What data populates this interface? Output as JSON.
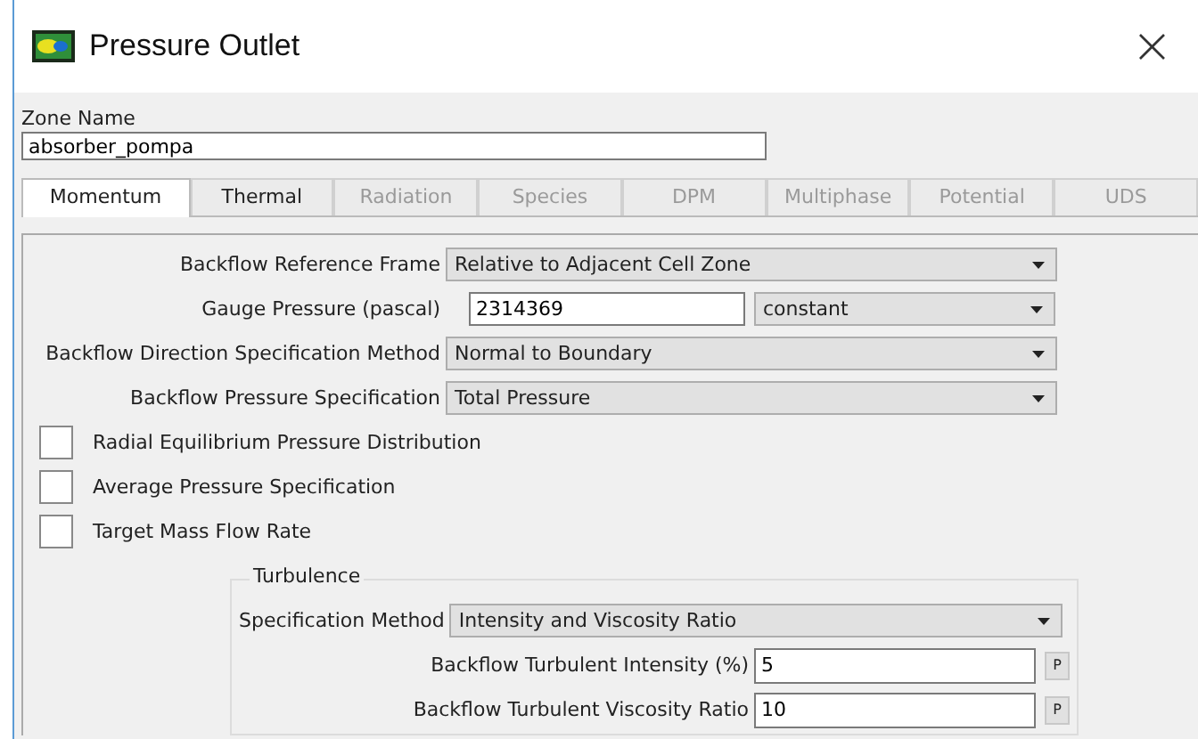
{
  "window": {
    "title": "Pressure Outlet",
    "close": "×"
  },
  "zone": {
    "label": "Zone Name",
    "value": "absorber_pompa"
  },
  "tabs": [
    {
      "label": "Momentum",
      "selected": true,
      "disabled": false
    },
    {
      "label": "Thermal",
      "selected": false,
      "disabled": false
    },
    {
      "label": "Radiation",
      "selected": false,
      "disabled": true
    },
    {
      "label": "Species",
      "selected": false,
      "disabled": true
    },
    {
      "label": "DPM",
      "selected": false,
      "disabled": true
    },
    {
      "label": "Multiphase",
      "selected": false,
      "disabled": true
    },
    {
      "label": "Potential",
      "selected": false,
      "disabled": true
    },
    {
      "label": "UDS",
      "selected": false,
      "disabled": true
    }
  ],
  "fields": [
    {
      "kind": "dropdown",
      "label": "Backflow Reference Frame",
      "value": "Relative to Adjacent Cell Zone"
    },
    {
      "kind": "input-dropdown",
      "label": "Gauge Pressure (pascal)",
      "value": "2314369",
      "option": "constant"
    },
    {
      "kind": "dropdown",
      "label": "Backflow Direction Specification Method",
      "value": "Normal to Boundary"
    },
    {
      "kind": "dropdown",
      "label": "Backflow Pressure Specification",
      "value": "Total Pressure"
    }
  ],
  "checkboxes": [
    {
      "label": "Radial Equilibrium Pressure Distribution",
      "checked": false
    },
    {
      "label": "Average Pressure Specification",
      "checked": false
    },
    {
      "label": "Target Mass Flow Rate",
      "checked": false
    }
  ],
  "turbulence": {
    "title": "Turbulence",
    "method": {
      "label": "Specification Method",
      "value": "Intensity and Viscosity Ratio"
    },
    "inputs": [
      {
        "label": "Backflow Turbulent Intensity (%)",
        "value": "5",
        "button": "P"
      },
      {
        "label": "Backflow Turbulent Viscosity Ratio",
        "value": "10",
        "button": "P"
      }
    ]
  }
}
